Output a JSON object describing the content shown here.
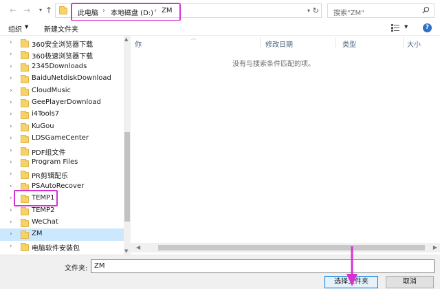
{
  "address": {
    "breadcrumbs": [
      "此电脑",
      "本地磁盘 (D:)",
      "ZM"
    ],
    "separator": "›"
  },
  "search": {
    "placeholder": "搜索\"ZM\""
  },
  "toolbar": {
    "organize": "组织",
    "new_folder": "新建文件夹"
  },
  "tree": [
    {
      "label": "360安全浏览器下载"
    },
    {
      "label": "360极速浏览器下载"
    },
    {
      "label": "2345Downloads"
    },
    {
      "label": "BaiduNetdiskDownload"
    },
    {
      "label": "CloudMusic"
    },
    {
      "label": "GeePlayerDownload"
    },
    {
      "label": "i4Tools7"
    },
    {
      "label": "KuGou"
    },
    {
      "label": "LDSGameCenter"
    },
    {
      "label": "PDF组文件"
    },
    {
      "label": "Program Files"
    },
    {
      "label": "PR剪辑配乐"
    },
    {
      "label": "PSAutoRecover"
    },
    {
      "label": "TEMP1"
    },
    {
      "label": "TEMP2"
    },
    {
      "label": "WeChat"
    },
    {
      "label": "ZM",
      "selected": true
    },
    {
      "label": "电脑软件安装包"
    }
  ],
  "columns": [
    "你",
    "修改日期",
    "类型",
    "大小"
  ],
  "empty_message": "没有与搜索条件匹配的项。",
  "filename": {
    "label": "文件夹:",
    "value": "ZM"
  },
  "buttons": {
    "select": "选择文件夹",
    "cancel": "取消"
  },
  "colors": {
    "highlight": "#d730d2",
    "selection": "#cce8ff",
    "folder": "#f6d26b"
  }
}
